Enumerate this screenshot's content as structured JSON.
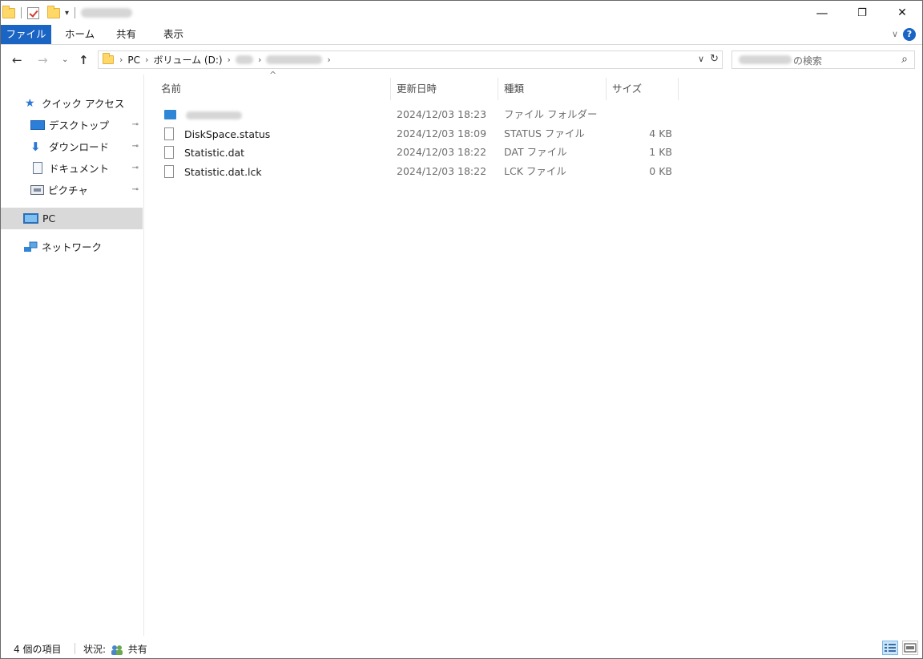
{
  "window": {
    "title_redacted": true,
    "controls": {
      "minimize": "—",
      "maximize": "❐",
      "close": "✕"
    }
  },
  "ribbon": {
    "tabs": [
      {
        "label": "ファイル"
      },
      {
        "label": "ホーム"
      },
      {
        "label": "共有"
      },
      {
        "label": "表示"
      }
    ],
    "expand_icon": "chevron-down-icon",
    "help_label": "?"
  },
  "navigation": {
    "back": "←",
    "forward": "→",
    "recent": "⌄",
    "up": "↑",
    "breadcrumb": {
      "pc": "PC",
      "volume": "ボリューム (D:)",
      "sep": "›"
    },
    "refresh": "↻",
    "dropdown": "⌄"
  },
  "search": {
    "placeholder_suffix": "の検索",
    "icon": "⌕"
  },
  "sidebar": {
    "quick_access": "クイック アクセス",
    "items": [
      {
        "label": "デスクトップ",
        "icon": "desktop-icon",
        "pinned": true
      },
      {
        "label": "ダウンロード",
        "icon": "download-icon",
        "pinned": true
      },
      {
        "label": "ドキュメント",
        "icon": "document-icon",
        "pinned": true
      },
      {
        "label": "ピクチャ",
        "icon": "picture-icon",
        "pinned": true
      }
    ],
    "pc": "PC",
    "network": "ネットワーク",
    "pin_glyph": "📌"
  },
  "columns": {
    "name": "名前",
    "date": "更新日時",
    "type": "種類",
    "size": "サイズ",
    "sort_indicator": "^"
  },
  "files": [
    {
      "name": "",
      "date": "2024/12/03 18:23",
      "type": "ファイル フォルダー",
      "size": "",
      "kind": "folder"
    },
    {
      "name": "DiskSpace.status",
      "date": "2024/12/03 18:09",
      "type": "STATUS ファイル",
      "size": "4 KB",
      "kind": "file"
    },
    {
      "name": "Statistic.dat",
      "date": "2024/12/03 18:22",
      "type": "DAT ファイル",
      "size": "1 KB",
      "kind": "file"
    },
    {
      "name": "Statistic.dat.lck",
      "date": "2024/12/03 18:22",
      "type": "LCK ファイル",
      "size": "0 KB",
      "kind": "file"
    }
  ],
  "status": {
    "count": "4 個の項目",
    "state_label": "状況:",
    "state_value": "共有"
  },
  "colors": {
    "accent": "#1a64c4",
    "selection": "#d9d9d9",
    "folder": "#ffd868"
  }
}
